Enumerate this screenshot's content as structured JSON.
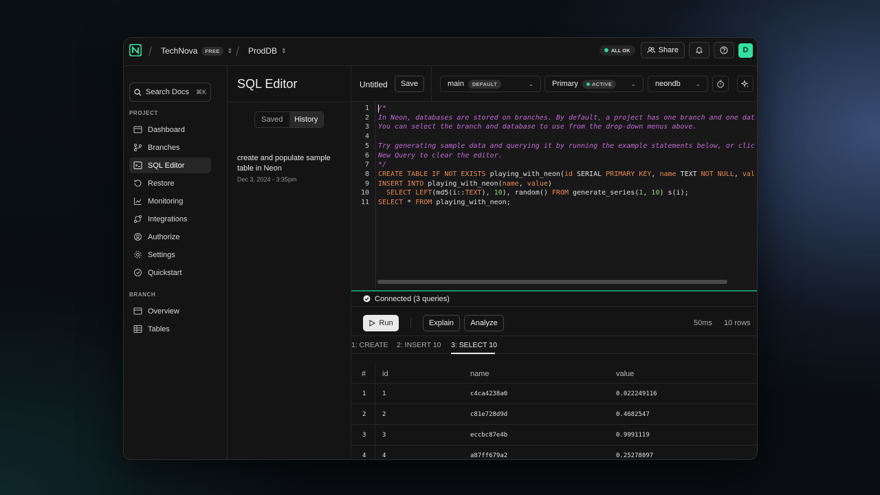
{
  "header": {
    "org": "TechNova",
    "org_badge": "FREE",
    "project": "ProdDB",
    "status": "ALL OK",
    "share": "Share",
    "avatar": "D"
  },
  "sidebar": {
    "search_label": "Search Docs",
    "search_shortcut": "⌘K",
    "project_title": "PROJECT",
    "project_items": [
      {
        "label": "Dashboard",
        "icon": "dashboard-icon"
      },
      {
        "label": "Branches",
        "icon": "branches-icon"
      },
      {
        "label": "SQL Editor",
        "icon": "sql-editor-icon"
      },
      {
        "label": "Restore",
        "icon": "restore-icon"
      },
      {
        "label": "Monitoring",
        "icon": "monitoring-icon"
      },
      {
        "label": "Integrations",
        "icon": "integrations-icon"
      },
      {
        "label": "Authorize",
        "icon": "authorize-icon"
      },
      {
        "label": "Settings",
        "icon": "settings-icon"
      },
      {
        "label": "Quickstart",
        "icon": "quickstart-icon"
      }
    ],
    "active": "SQL Editor",
    "branch_title": "BRANCH",
    "branch_items": [
      {
        "label": "Overview",
        "icon": "overview-icon"
      },
      {
        "label": "Tables",
        "icon": "tables-icon"
      }
    ]
  },
  "history": {
    "title": "SQL Editor",
    "tabs": [
      "Saved",
      "History"
    ],
    "active_tab": "History",
    "items": [
      {
        "title": "create and populate sample table in Neon",
        "date": "Dec 3, 2024 - 3:35pm"
      }
    ]
  },
  "toolbar": {
    "query_name": "Untitled",
    "save": "Save",
    "branch": "main",
    "branch_badge": "DEFAULT",
    "compute": "Primary",
    "compute_badge": "ACTIVE",
    "database": "neondb"
  },
  "editor": {
    "line_numbers": [
      "1",
      "2",
      "3",
      "4",
      "5",
      "6",
      "7",
      "8",
      "9",
      "10",
      "11"
    ],
    "lines": [
      [
        [
          "cm",
          "/*"
        ]
      ],
      [
        [
          "cm",
          "In Neon, databases are stored on branches. By default, a project has one branch and one dat"
        ]
      ],
      [
        [
          "cm",
          "You can select the branch and database to use from the drop-down menus above."
        ]
      ],
      [
        [
          "cm",
          ""
        ]
      ],
      [
        [
          "cm",
          "Try generating sample data and querying it by running the example statements below, or clic"
        ]
      ],
      [
        [
          "cm",
          "New Query to clear the editor."
        ]
      ],
      [
        [
          "cm",
          "*/"
        ]
      ],
      [
        [
          "kw",
          "CREATE TABLE IF NOT EXISTS "
        ],
        [
          "tx",
          "playing_with_neon("
        ],
        [
          "kw",
          "id "
        ],
        [
          "tx",
          "SERIAL "
        ],
        [
          "kw",
          "PRIMARY KEY"
        ],
        [
          "tx",
          ", "
        ],
        [
          "kw",
          "name "
        ],
        [
          "tx",
          "TEXT "
        ],
        [
          "kw",
          "NOT NULL"
        ],
        [
          "tx",
          ", "
        ],
        [
          "kw",
          "val"
        ]
      ],
      [
        [
          "kw",
          "INSERT INTO "
        ],
        [
          "tx",
          "playing_with_neon("
        ],
        [
          "kw",
          "name"
        ],
        [
          "tx",
          ", "
        ],
        [
          "kw",
          "value"
        ],
        [
          "tx",
          ")"
        ]
      ],
      [
        [
          "tx",
          "  "
        ],
        [
          "kw",
          "SELECT LEFT"
        ],
        [
          "tx",
          "(md5(i::"
        ],
        [
          "kw",
          "TEXT"
        ],
        [
          "tx",
          "), "
        ],
        [
          "num",
          "10"
        ],
        [
          "tx",
          "), random() "
        ],
        [
          "kw",
          "FROM "
        ],
        [
          "tx",
          "generate_series("
        ],
        [
          "num",
          "1"
        ],
        [
          "tx",
          ", "
        ],
        [
          "num",
          "10"
        ],
        [
          "tx",
          ") s(i);"
        ]
      ],
      [
        [
          "kw",
          "SELECT "
        ],
        [
          "tx",
          "* "
        ],
        [
          "kw",
          "FROM "
        ],
        [
          "tx",
          "playing_with_neon;"
        ]
      ]
    ]
  },
  "results": {
    "status": "Connected (3 queries)",
    "run": "Run",
    "explain": "Explain",
    "analyze": "Analyze",
    "duration": "50ms",
    "rows_count": "10 rows",
    "tabs": [
      "1: CREATE",
      "2: INSERT 10",
      "3: SELECT 10"
    ],
    "active_tab": "3: SELECT 10",
    "columns": [
      "#",
      "id",
      "name",
      "value"
    ],
    "rows": [
      [
        "1",
        "1",
        "c4ca4238a0",
        "0.022249116"
      ],
      [
        "2",
        "2",
        "c81e728d9d",
        "0.4682547"
      ],
      [
        "3",
        "3",
        "eccbc87e4b",
        "0.9991119"
      ],
      [
        "4",
        "4",
        "a87ff679a2",
        "0.25278097"
      ]
    ]
  }
}
